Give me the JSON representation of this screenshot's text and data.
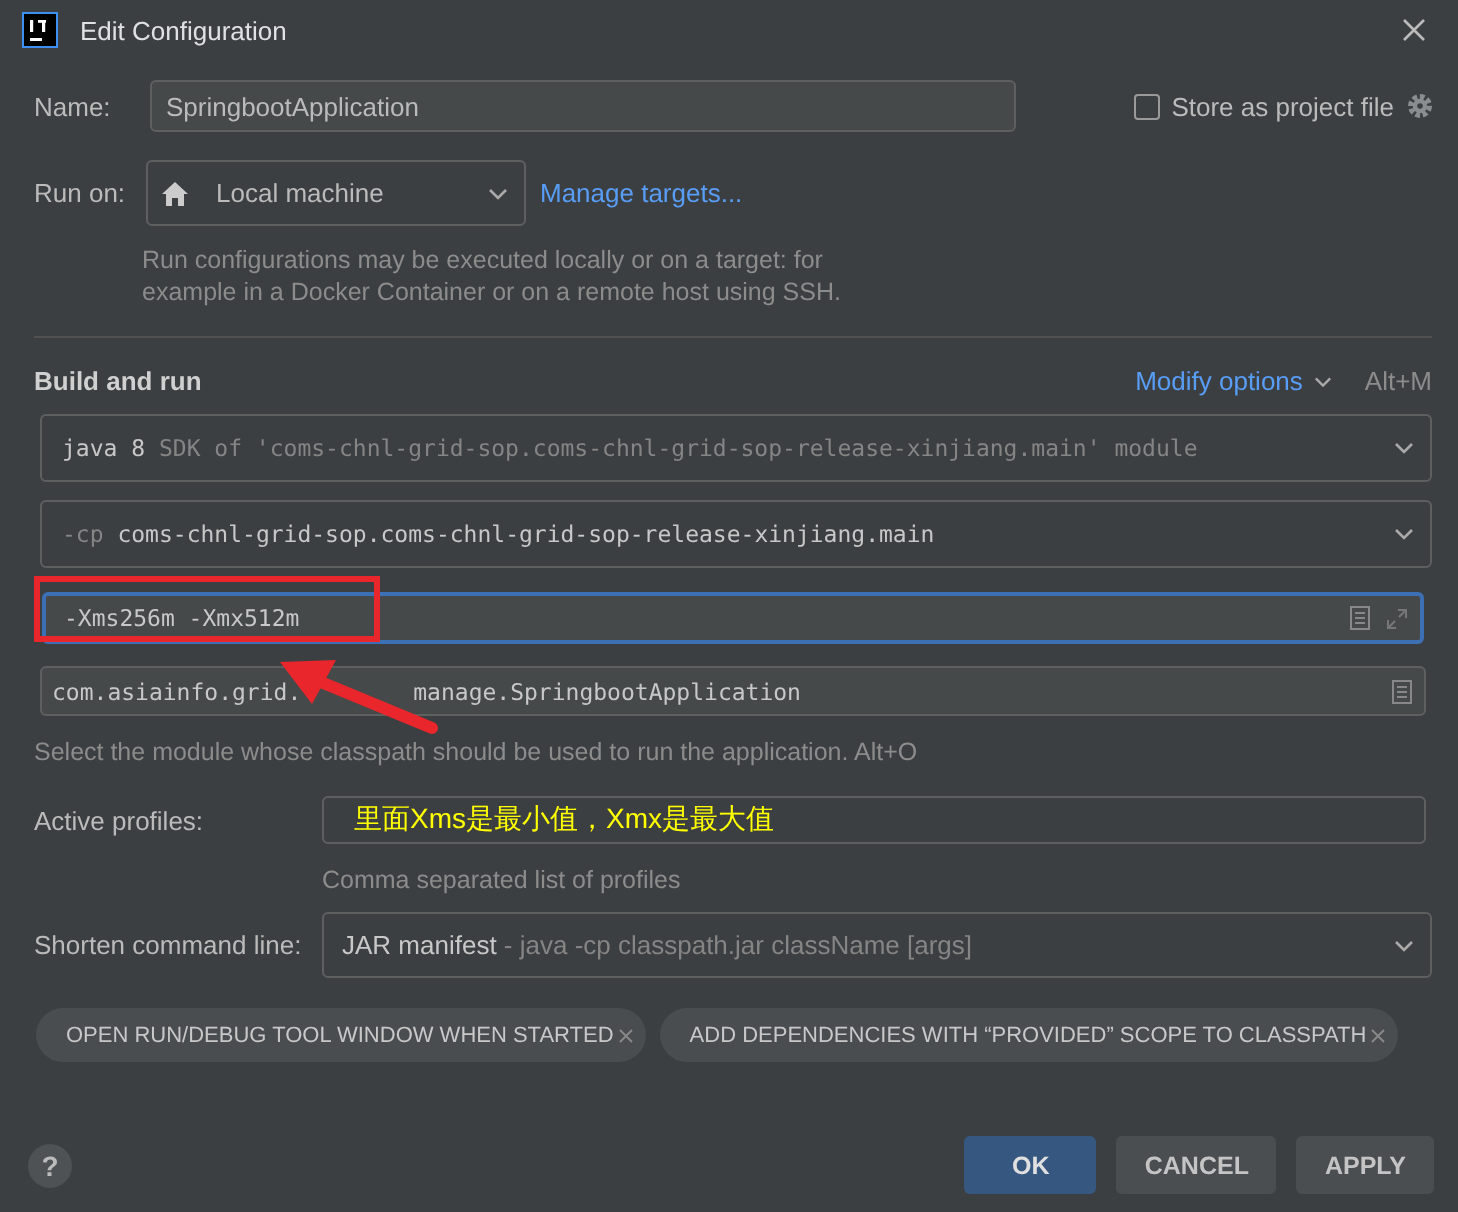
{
  "window": {
    "title": "Edit Configuration"
  },
  "name": {
    "label": "Name:",
    "value": "SpringbootApplication"
  },
  "store_as_project_file": {
    "label": "Store as project file",
    "checked": false
  },
  "run_on": {
    "label": "Run on:",
    "value": "Local machine",
    "link": "Manage targets...",
    "help": "Run configurations may be executed locally or on a target: for example in a Docker Container or on a remote host using SSH."
  },
  "build_and_run": {
    "title": "Build and run",
    "modify_options": "Modify options",
    "shortcut": "Alt+M",
    "jre": {
      "value": "java 8",
      "hint": "SDK of 'coms-chnl-grid-sop.coms-chnl-grid-sop-release-xinjiang.main' module"
    },
    "classpath": {
      "prefix": "-cp",
      "value": "coms-chnl-grid-sop.coms-chnl-grid-sop-release-xinjiang.main"
    },
    "vm_options": {
      "value": "-Xms256m -Xmx512m"
    },
    "main_class": {
      "parts": [
        "com.asiainfo.grid.",
        "manage.SpringbootApplication"
      ]
    },
    "module_hint": "Select the module whose classpath should be used to run the application. Alt+O"
  },
  "active_profiles": {
    "label": "Active profiles:",
    "annotation": "里面Xms是最小值，Xmx是最大值",
    "hint": "Comma separated list of profiles"
  },
  "shorten_command_line": {
    "label": "Shorten command line:",
    "value": "JAR manifest",
    "hint": "- java -cp classpath.jar className [args]"
  },
  "options": [
    {
      "label": "OPEN RUN/DEBUG TOOL WINDOW WHEN STARTED"
    },
    {
      "label": "ADD DEPENDENCIES WITH “PROVIDED” SCOPE TO CLASSPATH"
    }
  ],
  "help_button": "?",
  "buttons": [
    {
      "label": "OK",
      "kind": "primary"
    },
    {
      "label": "CANCEL",
      "kind": "default"
    },
    {
      "label": "APPLY",
      "kind": "default"
    }
  ]
}
